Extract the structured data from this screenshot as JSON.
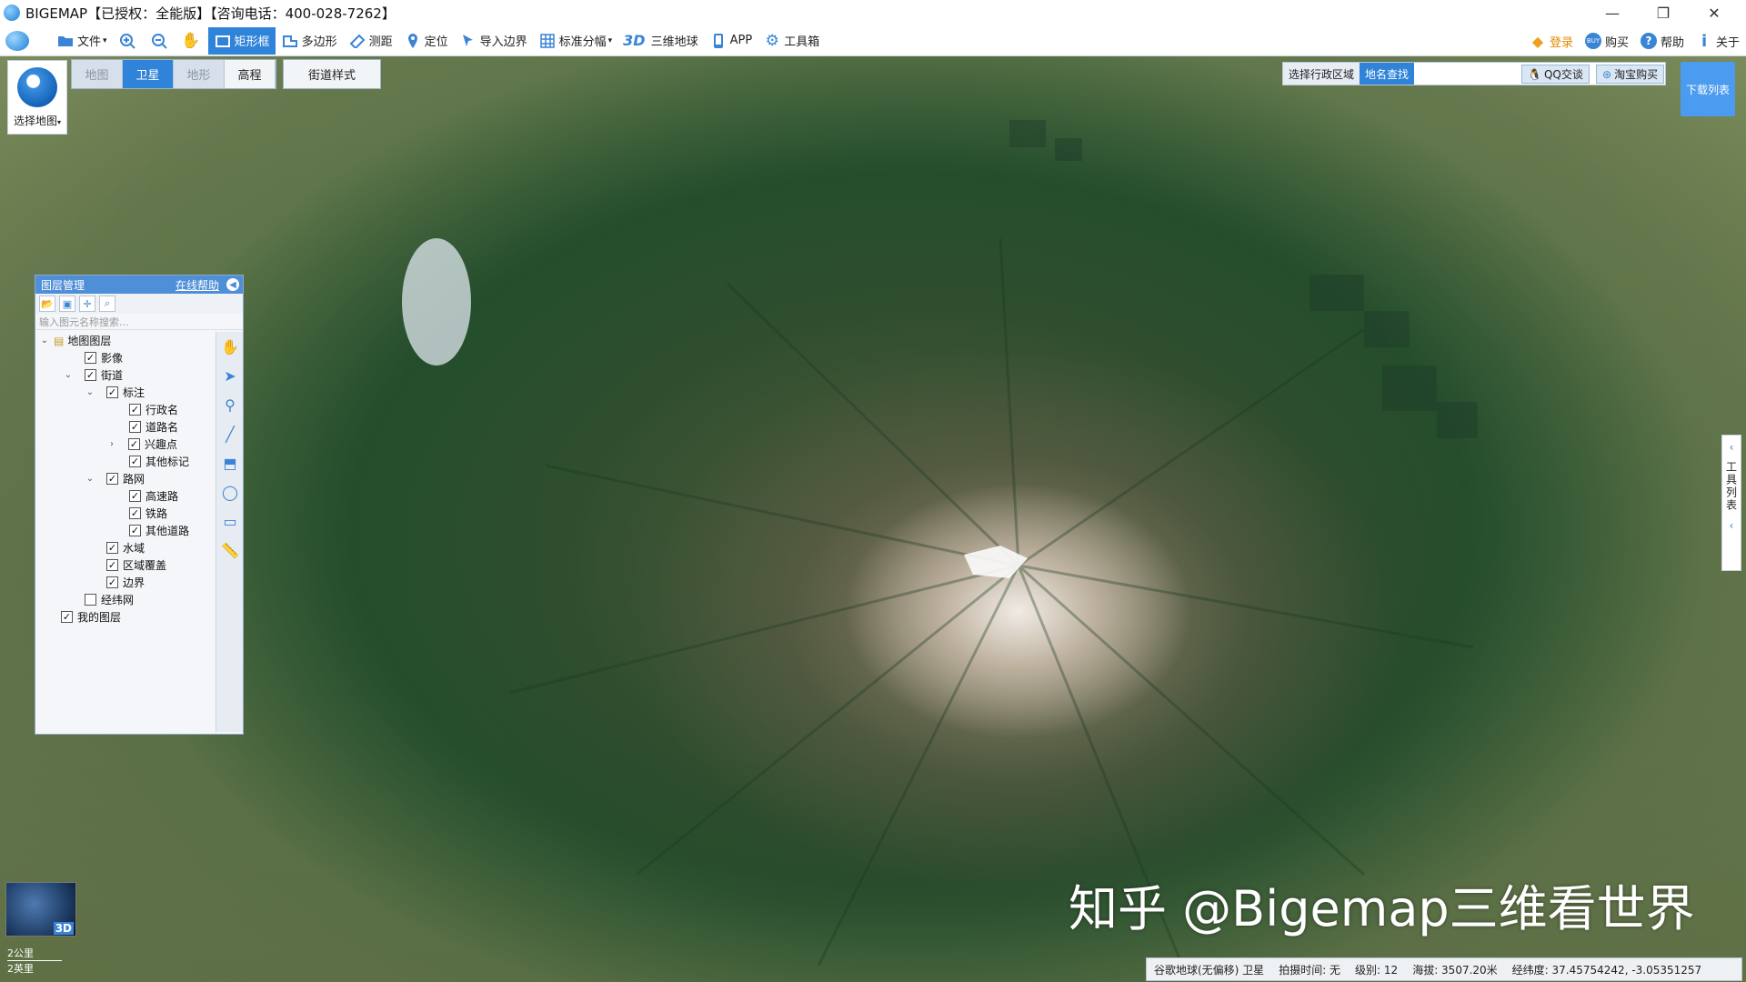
{
  "window": {
    "title": "BIGEMAP【已授权：全能版】【咨询电话：400-028-7262】",
    "controls": [
      "—",
      "❐",
      "✕"
    ]
  },
  "toolbar": {
    "file": "文件",
    "rectangle": "矩形框",
    "polygon": "多边形",
    "measure": "测距",
    "locate": "定位",
    "import_boundary": "导入边界",
    "grid_split": "标准分幅",
    "three_d_label": "3D",
    "globe_3d": "三维地球",
    "app": "APP",
    "toolbox": "工具箱",
    "login": "登录",
    "buy": "购买",
    "help": "帮助",
    "about": "关于"
  },
  "map_chooser": {
    "label": "选择地图"
  },
  "map_tabs": [
    "地图",
    "卫星",
    "地形",
    "高程"
  ],
  "street_style": "街道样式",
  "search_bar": {
    "tab_region": "选择行政区域",
    "tab_place": "地名查找",
    "qq": "QQ交谈",
    "taobao": "淘宝购买"
  },
  "download_list": "下载列表",
  "layer_panel": {
    "title": "图层管理",
    "help_link": "在线帮助",
    "search_placeholder": "输入图元名称搜索...",
    "tree": {
      "map_layers": "地图图层",
      "imagery": "影像",
      "streets": "街道",
      "annotation": "标注",
      "admin_names": "行政名",
      "road_names": "道路名",
      "poi": "兴趣点",
      "other_marks": "其他标记",
      "road_network": "路网",
      "highway": "高速路",
      "railway": "铁路",
      "other_roads": "其他道路",
      "water": "水域",
      "area_cover": "区域覆盖",
      "border": "边界",
      "graticule": "经纬网",
      "my_layers": "我的图层"
    }
  },
  "tool_list": {
    "label": "工具列表"
  },
  "mini_globe": {
    "label": "3D"
  },
  "scale": {
    "metric": "2公里",
    "imperial": "2英里"
  },
  "watermark": "知乎 @Bigemap三维看世界",
  "status_bar": {
    "source": "谷歌地球(无偏移) 卫星",
    "capture_time": "拍摄时间: 无",
    "level": "级别:  12",
    "altitude": "海拔: 3507.20米",
    "lonlat": "经纬度:  37.45754242, -3.05351257"
  },
  "colors": {
    "accent": "#2f83d8",
    "panel_header": "#4e8fd8",
    "download": "#4b9cf0"
  }
}
